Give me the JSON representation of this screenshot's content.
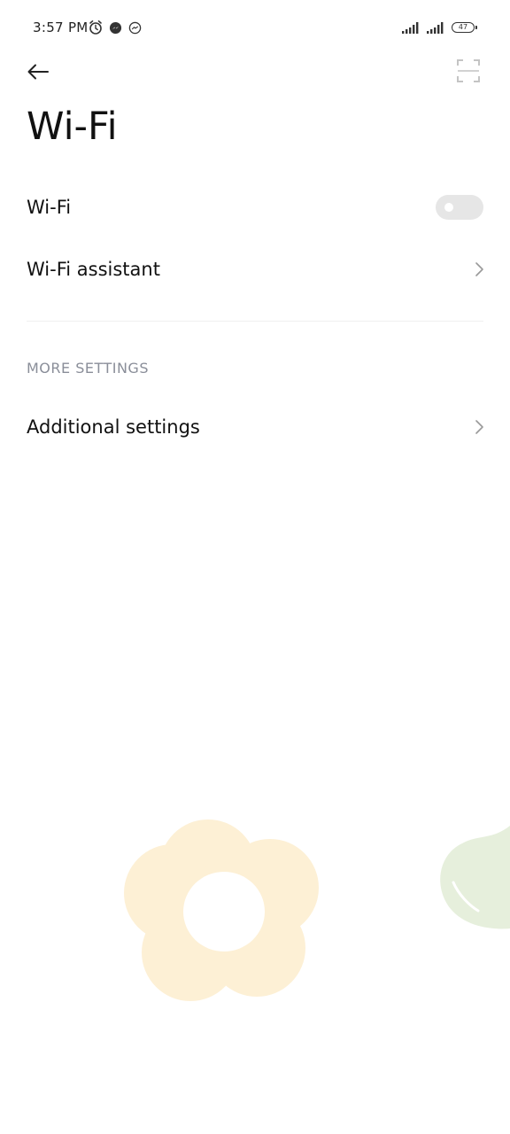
{
  "status_bar": {
    "time": "3:57 PM",
    "icons": [
      "alarm-icon",
      "messenger-icon",
      "messenger-outline-icon"
    ],
    "signal_icons": [
      "signal-1-icon",
      "signal-2-icon"
    ],
    "battery": "47"
  },
  "nav": {
    "back_icon": "arrow-left-icon",
    "scan_icon": "scan-frame-icon"
  },
  "page": {
    "title": "Wi-Fi"
  },
  "settings": {
    "wifi_label": "Wi-Fi",
    "wifi_enabled": false,
    "assistant_label": "Wi-Fi assistant",
    "section_header": "MORE SETTINGS",
    "additional_label": "Additional settings"
  },
  "colors": {
    "background": "#ffffff",
    "text": "#111111",
    "section_header": "#8a8e99",
    "toggle_off": "#e6e6e6",
    "wallpaper_flower": "#fdf0d5",
    "wallpaper_leaf": "#e6efdc"
  }
}
